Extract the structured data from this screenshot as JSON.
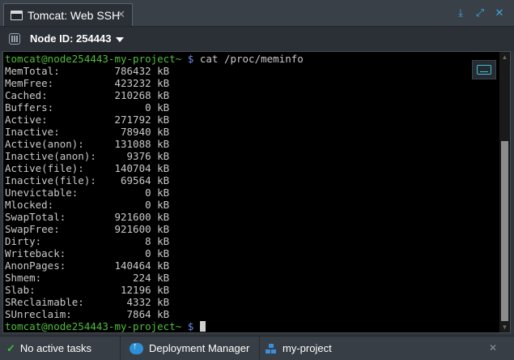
{
  "window": {
    "tab_title": "Tomcat: Web SSH",
    "close_symbol": "✕",
    "controls": {
      "download": "⤓",
      "expand": "⤢",
      "close": "✕"
    }
  },
  "toolbar": {
    "node_label": "Node ID: 254443"
  },
  "terminal": {
    "command_prompt": "tomcat@node254443-my-project~",
    "prompt_symbol": "$",
    "command": "cat /proc/meminfo",
    "lines": [
      "MemTotal:         786432 kB",
      "MemFree:          423232 kB",
      "Cached:           210268 kB",
      "Buffers:               0 kB",
      "Active:           271792 kB",
      "Inactive:          78940 kB",
      "Active(anon):     131088 kB",
      "Inactive(anon):     9376 kB",
      "Active(file):     140704 kB",
      "Inactive(file):    69564 kB",
      "Unevictable:           0 kB",
      "Mlocked:               0 kB",
      "SwapTotal:        921600 kB",
      "SwapFree:         921600 kB",
      "Dirty:                 8 kB",
      "Writeback:             0 kB",
      "AnonPages:        140464 kB",
      "Shmem:               224 kB",
      "Slab:              12196 kB",
      "SReclaimable:       4332 kB",
      "SUnreclaim:         7864 kB"
    ],
    "final_prompt": "tomcat@node254443-my-project~",
    "scroll_up": "▲",
    "scroll_down": "▼"
  },
  "statusbar": {
    "tasks_label": "No active tasks",
    "deployment_manager_label": "Deployment Manager",
    "project_label": "my-project",
    "check_symbol": "✓",
    "close_symbol": "✕"
  },
  "colors": {
    "prompt_green": "#4fbf3a",
    "prompt_symbol_blue": "#6a8ce8",
    "accent_blue": "#3ea6dc"
  }
}
